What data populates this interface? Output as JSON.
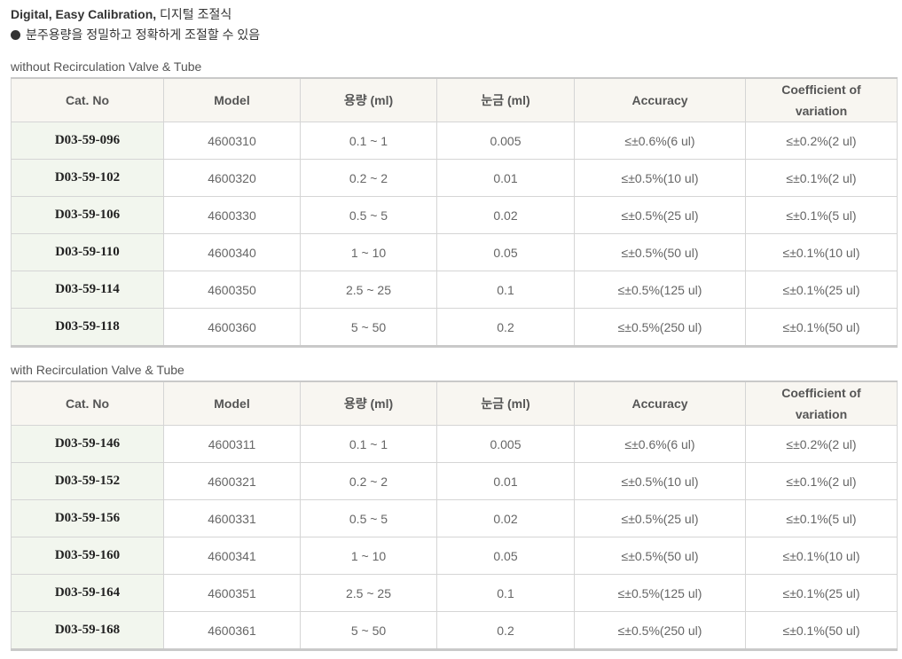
{
  "header": {
    "title_bold": "Digital, Easy Calibration,",
    "title_rest": " 디지털 조절식",
    "subtitle": "분주용량을 정밀하고 정확하게 조절할 수 있음"
  },
  "columns": [
    "Cat. No",
    "Model",
    "용량 (ml)",
    "눈금 (ml)",
    "Accuracy",
    "Coefficient of variation"
  ],
  "columns_split": {
    "cv_line1": "Coefficient of",
    "cv_line2": "variation"
  },
  "tables": [
    {
      "title": "without Recirculation Valve & Tube",
      "rows": [
        [
          "D03-59-096",
          "4600310",
          "0.1 ~ 1",
          "0.005",
          "≤±0.6%(6 ul)",
          "≤±0.2%(2 ul)"
        ],
        [
          "D03-59-102",
          "4600320",
          "0.2 ~ 2",
          "0.01",
          "≤±0.5%(10 ul)",
          "≤±0.1%(2 ul)"
        ],
        [
          "D03-59-106",
          "4600330",
          "0.5 ~ 5",
          "0.02",
          "≤±0.5%(25 ul)",
          "≤±0.1%(5 ul)"
        ],
        [
          "D03-59-110",
          "4600340",
          "1 ~ 10",
          "0.05",
          "≤±0.5%(50 ul)",
          "≤±0.1%(10 ul)"
        ],
        [
          "D03-59-114",
          "4600350",
          "2.5 ~ 25",
          "0.1",
          "≤±0.5%(125 ul)",
          "≤±0.1%(25 ul)"
        ],
        [
          "D03-59-118",
          "4600360",
          "5 ~ 50",
          "0.2",
          "≤±0.5%(250 ul)",
          "≤±0.1%(50 ul)"
        ]
      ]
    },
    {
      "title": "with Recirculation Valve & Tube",
      "rows": [
        [
          "D03-59-146",
          "4600311",
          "0.1 ~ 1",
          "0.005",
          "≤±0.6%(6 ul)",
          "≤±0.2%(2 ul)"
        ],
        [
          "D03-59-152",
          "4600321",
          "0.2 ~ 2",
          "0.01",
          "≤±0.5%(10 ul)",
          "≤±0.1%(2 ul)"
        ],
        [
          "D03-59-156",
          "4600331",
          "0.5 ~ 5",
          "0.02",
          "≤±0.5%(25 ul)",
          "≤±0.1%(5 ul)"
        ],
        [
          "D03-59-160",
          "4600341",
          "1 ~ 10",
          "0.05",
          "≤±0.5%(50 ul)",
          "≤±0.1%(10 ul)"
        ],
        [
          "D03-59-164",
          "4600351",
          "2.5 ~ 25",
          "0.1",
          "≤±0.5%(125 ul)",
          "≤±0.1%(25 ul)"
        ],
        [
          "D03-59-168",
          "4600361",
          "5 ~ 50",
          "0.2",
          "≤±0.5%(250 ul)",
          "≤±0.1%(50 ul)"
        ]
      ]
    }
  ]
}
